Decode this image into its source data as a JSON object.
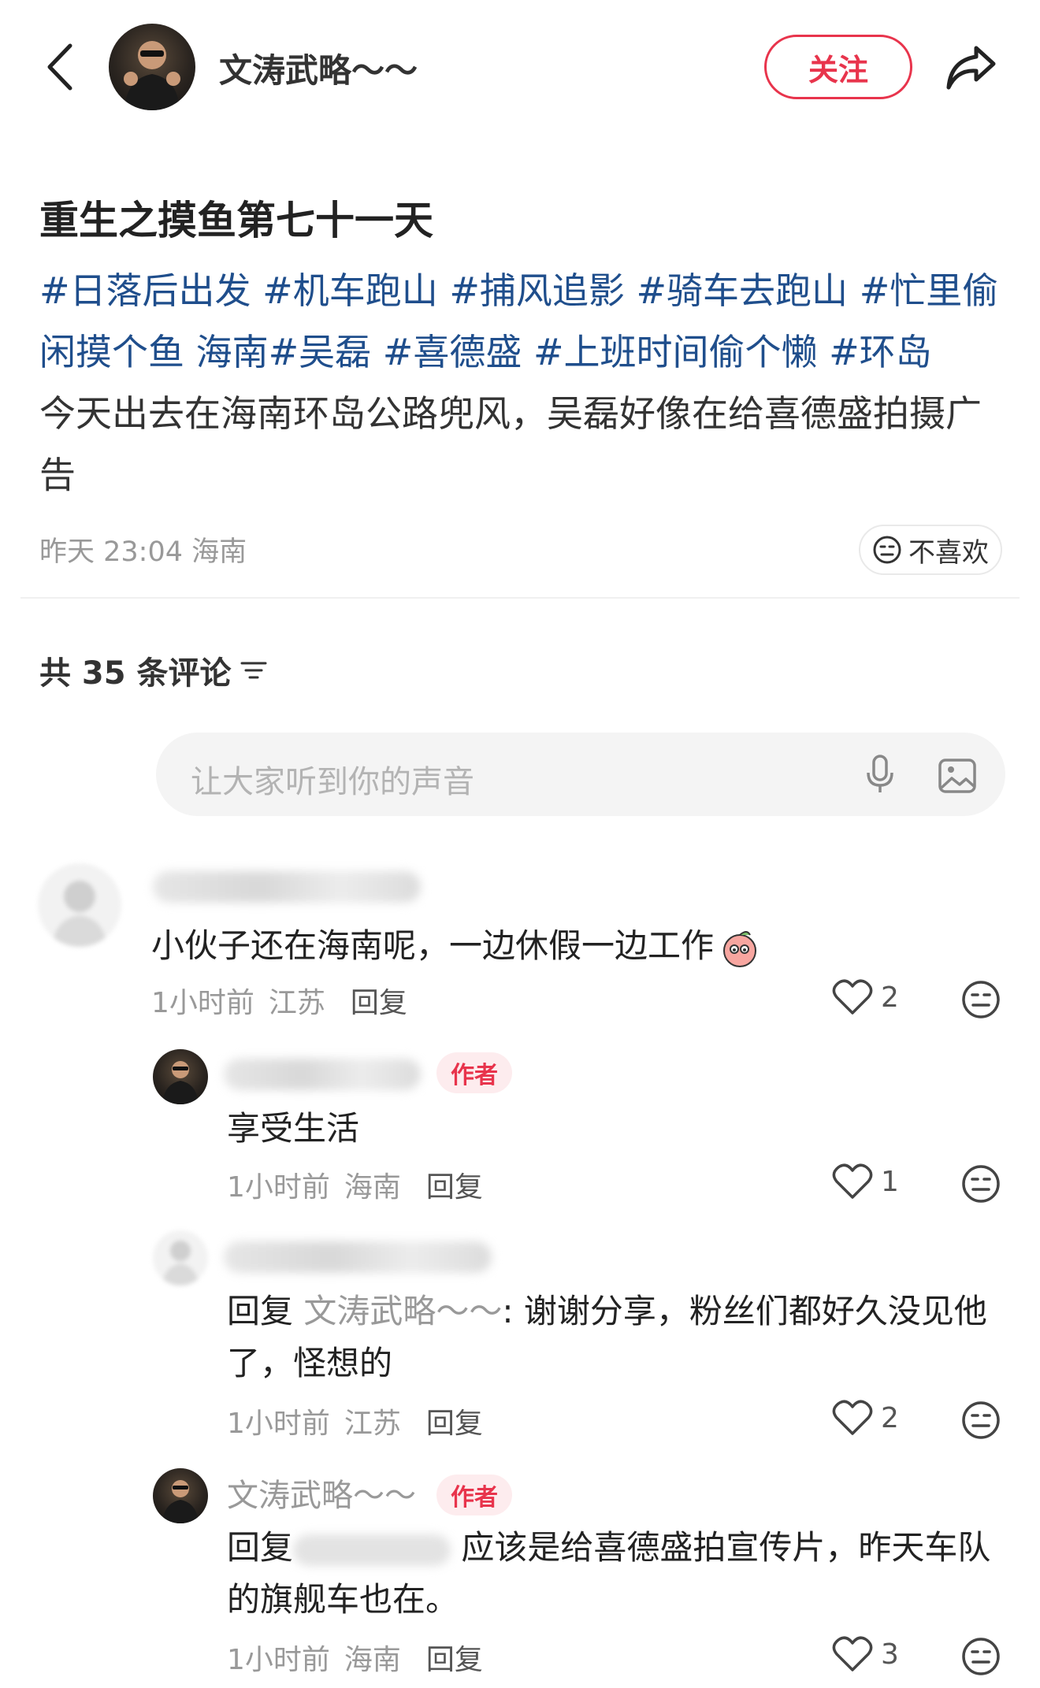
{
  "header": {
    "author_name": "文涛武略～～",
    "follow_label": "关注"
  },
  "post": {
    "title": "重生之摸鱼第七十一天",
    "hashtags_line": [
      "#日落后出发",
      "#机车跑山",
      "#捕风追影",
      "#骑车去跑山",
      "#忙里偷闲摸个鱼",
      "海南",
      "#吴磊",
      "#喜德盛",
      "#上班时间偷个懒",
      "#环岛"
    ],
    "body_text": "今天出去在海南环岛公路兜风，吴磊好像在给喜德盛拍摄广告",
    "time": "昨天 23:04",
    "location": "海南",
    "dislike_label": "不喜欢"
  },
  "comments_header": {
    "label": "共 35 条评论"
  },
  "comment_input": {
    "placeholder": "让大家听到你的声音"
  },
  "comments": [
    {
      "text": "小伙子还在海南呢，一边休假一边工作",
      "time": "1小时前",
      "location": "江苏",
      "reply_label": "回复",
      "likes": "2"
    },
    {
      "author_tag": "作者",
      "text": "享受生活",
      "time": "1小时前",
      "location": "海南",
      "reply_label": "回复",
      "likes": "1"
    },
    {
      "reply_prefix": "回复",
      "reply_to": "文涛武略～～",
      "text": ": 谢谢分享，粉丝们都好久没见他了，怪想的",
      "time": "1小时前",
      "location": "江苏",
      "reply_label": "回复",
      "likes": "2"
    },
    {
      "name": "文涛武略～～",
      "author_tag": "作者",
      "reply_prefix": "回复",
      "text": "应该是给喜德盛拍宣传片，昨天车队的旗舰车也在。",
      "time": "1小时前",
      "location": "海南",
      "reply_label": "回复",
      "likes": "3"
    }
  ],
  "colors": {
    "accent": "#e8344c",
    "hashtag": "#1f4e8c",
    "meta": "#999999"
  },
  "icons": [
    "back-arrow-icon",
    "share-icon",
    "dislike-face-icon",
    "filter-icon",
    "mic-icon",
    "image-icon",
    "heart-icon",
    "neutral-face-icon",
    "peach-sticker-icon"
  ]
}
